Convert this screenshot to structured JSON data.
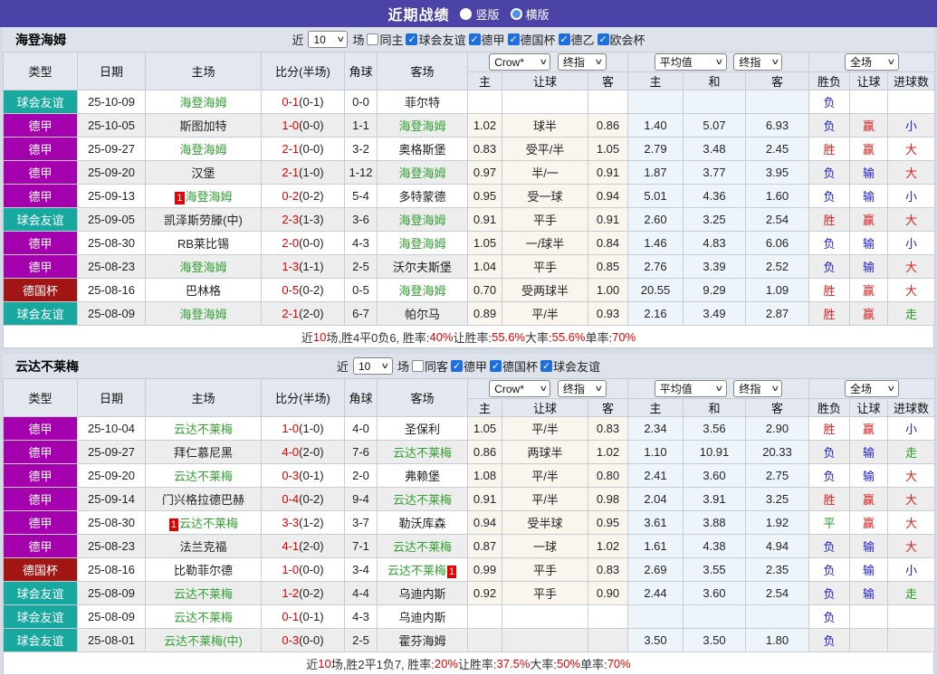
{
  "title_bar": {
    "title": "近期战绩",
    "vertical": "竖版",
    "horizontal": "横版",
    "selected": "竖版"
  },
  "colors": {
    "title_bar_bg": "#4b43a6",
    "highlight_team": "#33a033",
    "score_red": "#e60000",
    "odds_col_bg": "#faf6ee",
    "avg_col_bg": "#edf5fb"
  },
  "type_colors": {
    "球会友谊": "#18a8a0",
    "德甲": "#a400ae",
    "德国杯": "#a21515"
  },
  "value_colors": {
    "胜": "#d92222",
    "赢": "#d92222",
    "大": "#d92222",
    "负": "#2222cc",
    "输": "#2222cc",
    "小": "#2222cc",
    "平": "#229922",
    "走": "#229922"
  },
  "table_header": {
    "type": "类型",
    "date": "日期",
    "home": "主场",
    "score": "比分(半场)",
    "corner": "角球",
    "away": "客场",
    "odds_source_select": "Crow*",
    "odds_final_select": "终指",
    "avg_select": "平均值",
    "avg_final_select": "终指",
    "scope_select": "全场",
    "odds_home": "主",
    "odds_handicap": "让球",
    "odds_away": "客",
    "avg_home": "主",
    "avg_draw": "和",
    "avg_away": "客",
    "result": "胜负",
    "handicap": "让球",
    "goals": "进球数"
  },
  "sections": [
    {
      "team": "海登海姆",
      "filters": {
        "near_label": "近",
        "count": "10",
        "games_label": "场",
        "same_label": "同主",
        "leagues": [
          "球会友谊",
          "德甲",
          "德国杯",
          "德乙",
          "欧会杯"
        ]
      },
      "rows": [
        {
          "type": "球会友谊",
          "date": "25-10-09",
          "home": "海登海姆",
          "home_hl": true,
          "home_badge": "",
          "score": "0-1",
          "half": "(0-1)",
          "corner": "0-0",
          "away": "菲尔特",
          "away_hl": false,
          "away_badge": "",
          "crow": [
            "",
            "",
            ""
          ],
          "avg": [
            "",
            "",
            ""
          ],
          "result": "负",
          "handicap_result": "",
          "goals": ""
        },
        {
          "type": "德甲",
          "date": "25-10-05",
          "home": "斯图加特",
          "home_hl": false,
          "home_badge": "",
          "score": "1-0",
          "half": "(0-0)",
          "corner": "1-1",
          "away": "海登海姆",
          "away_hl": true,
          "away_badge": "",
          "crow": [
            "1.02",
            "球半",
            "0.86"
          ],
          "avg": [
            "1.40",
            "5.07",
            "6.93"
          ],
          "result": "负",
          "handicap_result": "赢",
          "goals": "小"
        },
        {
          "type": "德甲",
          "date": "25-09-27",
          "home": "海登海姆",
          "home_hl": true,
          "home_badge": "",
          "score": "2-1",
          "half": "(0-0)",
          "corner": "3-2",
          "away": "奥格斯堡",
          "away_hl": false,
          "away_badge": "",
          "crow": [
            "0.83",
            "受平/半",
            "1.05"
          ],
          "avg": [
            "2.79",
            "3.48",
            "2.45"
          ],
          "result": "胜",
          "handicap_result": "赢",
          "goals": "大"
        },
        {
          "type": "德甲",
          "date": "25-09-20",
          "home": "汉堡",
          "home_hl": false,
          "home_badge": "",
          "score": "2-1",
          "half": "(1-0)",
          "corner": "1-12",
          "away": "海登海姆",
          "away_hl": true,
          "away_badge": "",
          "crow": [
            "0.97",
            "半/一",
            "0.91"
          ],
          "avg": [
            "1.87",
            "3.77",
            "3.95"
          ],
          "result": "负",
          "handicap_result": "输",
          "goals": "大"
        },
        {
          "type": "德甲",
          "date": "25-09-13",
          "home": "海登海姆",
          "home_hl": true,
          "home_badge": "1",
          "score": "0-2",
          "half": "(0-2)",
          "corner": "5-4",
          "away": "多特蒙德",
          "away_hl": false,
          "away_badge": "",
          "crow": [
            "0.95",
            "受一球",
            "0.94"
          ],
          "avg": [
            "5.01",
            "4.36",
            "1.60"
          ],
          "result": "负",
          "handicap_result": "输",
          "goals": "小"
        },
        {
          "type": "球会友谊",
          "date": "25-09-05",
          "home": "凯泽斯劳滕(中)",
          "home_hl": false,
          "home_badge": "",
          "score": "2-3",
          "half": "(1-3)",
          "corner": "3-6",
          "away": "海登海姆",
          "away_hl": true,
          "away_badge": "",
          "crow": [
            "0.91",
            "平手",
            "0.91"
          ],
          "avg": [
            "2.60",
            "3.25",
            "2.54"
          ],
          "result": "胜",
          "handicap_result": "赢",
          "goals": "大"
        },
        {
          "type": "德甲",
          "date": "25-08-30",
          "home": "RB莱比锡",
          "home_hl": false,
          "home_badge": "",
          "score": "2-0",
          "half": "(0-0)",
          "corner": "4-3",
          "away": "海登海姆",
          "away_hl": true,
          "away_badge": "",
          "crow": [
            "1.05",
            "一/球半",
            "0.84"
          ],
          "avg": [
            "1.46",
            "4.83",
            "6.06"
          ],
          "result": "负",
          "handicap_result": "输",
          "goals": "小"
        },
        {
          "type": "德甲",
          "date": "25-08-23",
          "home": "海登海姆",
          "home_hl": true,
          "home_badge": "",
          "score": "1-3",
          "half": "(1-1)",
          "corner": "2-5",
          "away": "沃尔夫斯堡",
          "away_hl": false,
          "away_badge": "",
          "crow": [
            "1.04",
            "平手",
            "0.85"
          ],
          "avg": [
            "2.76",
            "3.39",
            "2.52"
          ],
          "result": "负",
          "handicap_result": "输",
          "goals": "大"
        },
        {
          "type": "德国杯",
          "date": "25-08-16",
          "home": "巴林格",
          "home_hl": false,
          "home_badge": "",
          "score": "0-5",
          "half": "(0-2)",
          "corner": "0-5",
          "away": "海登海姆",
          "away_hl": true,
          "away_badge": "",
          "crow": [
            "0.70",
            "受两球半",
            "1.00"
          ],
          "avg": [
            "20.55",
            "9.29",
            "1.09"
          ],
          "result": "胜",
          "handicap_result": "赢",
          "goals": "大"
        },
        {
          "type": "球会友谊",
          "date": "25-08-09",
          "home": "海登海姆",
          "home_hl": true,
          "home_badge": "",
          "score": "2-1",
          "half": "(2-0)",
          "corner": "6-7",
          "away": "帕尔马",
          "away_hl": false,
          "away_badge": "",
          "crow": [
            "0.89",
            "平/半",
            "0.93"
          ],
          "avg": [
            "2.16",
            "3.49",
            "2.87"
          ],
          "result": "胜",
          "handicap_result": "赢",
          "goals": "走"
        }
      ],
      "summary": [
        {
          "text": "近",
          "red": false
        },
        {
          "text": "10",
          "red": true
        },
        {
          "text": "场,胜4平0负6, 胜率:",
          "red": false
        },
        {
          "text": "40%",
          "red": true
        },
        {
          "text": " 让胜率:",
          "red": false
        },
        {
          "text": "55.6%",
          "red": true
        },
        {
          "text": " 大率:",
          "red": false
        },
        {
          "text": "55.6%",
          "red": true
        },
        {
          "text": " 单率:",
          "red": false
        },
        {
          "text": "70%",
          "red": true
        }
      ]
    },
    {
      "team": "云达不莱梅",
      "filters": {
        "near_label": "近",
        "count": "10",
        "games_label": "场",
        "same_label": "同客",
        "leagues": [
          "德甲",
          "德国杯",
          "球会友谊"
        ]
      },
      "rows": [
        {
          "type": "德甲",
          "date": "25-10-04",
          "home": "云达不莱梅",
          "home_hl": true,
          "home_badge": "",
          "score": "1-0",
          "half": "(1-0)",
          "corner": "4-0",
          "away": "圣保利",
          "away_hl": false,
          "away_badge": "",
          "crow": [
            "1.05",
            "平/半",
            "0.83"
          ],
          "avg": [
            "2.34",
            "3.56",
            "2.90"
          ],
          "result": "胜",
          "handicap_result": "赢",
          "goals": "小"
        },
        {
          "type": "德甲",
          "date": "25-09-27",
          "home": "拜仁慕尼黑",
          "home_hl": false,
          "home_badge": "",
          "score": "4-0",
          "half": "(2-0)",
          "corner": "7-6",
          "away": "云达不莱梅",
          "away_hl": true,
          "away_badge": "",
          "crow": [
            "0.86",
            "两球半",
            "1.02"
          ],
          "avg": [
            "1.10",
            "10.91",
            "20.33"
          ],
          "result": "负",
          "handicap_result": "输",
          "goals": "走"
        },
        {
          "type": "德甲",
          "date": "25-09-20",
          "home": "云达不莱梅",
          "home_hl": true,
          "home_badge": "",
          "score": "0-3",
          "half": "(0-1)",
          "corner": "2-0",
          "away": "弗赖堡",
          "away_hl": false,
          "away_badge": "",
          "crow": [
            "1.08",
            "平/半",
            "0.80"
          ],
          "avg": [
            "2.41",
            "3.60",
            "2.75"
          ],
          "result": "负",
          "handicap_result": "输",
          "goals": "大"
        },
        {
          "type": "德甲",
          "date": "25-09-14",
          "home": "门兴格拉德巴赫",
          "home_hl": false,
          "home_badge": "",
          "score": "0-4",
          "half": "(0-2)",
          "corner": "9-4",
          "away": "云达不莱梅",
          "away_hl": true,
          "away_badge": "",
          "crow": [
            "0.91",
            "平/半",
            "0.98"
          ],
          "avg": [
            "2.04",
            "3.91",
            "3.25"
          ],
          "result": "胜",
          "handicap_result": "赢",
          "goals": "大"
        },
        {
          "type": "德甲",
          "date": "25-08-30",
          "home": "云达不莱梅",
          "home_hl": true,
          "home_badge": "1",
          "score": "3-3",
          "half": "(1-2)",
          "corner": "3-7",
          "away": "勒沃库森",
          "away_hl": false,
          "away_badge": "",
          "crow": [
            "0.94",
            "受半球",
            "0.95"
          ],
          "avg": [
            "3.61",
            "3.88",
            "1.92"
          ],
          "result": "平",
          "handicap_result": "赢",
          "goals": "大"
        },
        {
          "type": "德甲",
          "date": "25-08-23",
          "home": "法兰克福",
          "home_hl": false,
          "home_badge": "",
          "score": "4-1",
          "half": "(2-0)",
          "corner": "7-1",
          "away": "云达不莱梅",
          "away_hl": true,
          "away_badge": "",
          "crow": [
            "0.87",
            "一球",
            "1.02"
          ],
          "avg": [
            "1.61",
            "4.38",
            "4.94"
          ],
          "result": "负",
          "handicap_result": "输",
          "goals": "大"
        },
        {
          "type": "德国杯",
          "date": "25-08-16",
          "home": "比勒菲尔德",
          "home_hl": false,
          "home_badge": "",
          "score": "1-0",
          "half": "(0-0)",
          "corner": "3-4",
          "away": "云达不莱梅",
          "away_hl": true,
          "away_badge": "1",
          "crow": [
            "0.99",
            "平手",
            "0.83"
          ],
          "avg": [
            "2.69",
            "3.55",
            "2.35"
          ],
          "result": "负",
          "handicap_result": "输",
          "goals": "小"
        },
        {
          "type": "球会友谊",
          "date": "25-08-09",
          "home": "云达不莱梅",
          "home_hl": true,
          "home_badge": "",
          "score": "1-2",
          "half": "(0-2)",
          "corner": "4-4",
          "away": "乌迪内斯",
          "away_hl": false,
          "away_badge": "",
          "crow": [
            "0.92",
            "平手",
            "0.90"
          ],
          "avg": [
            "2.44",
            "3.60",
            "2.54"
          ],
          "result": "负",
          "handicap_result": "输",
          "goals": "走"
        },
        {
          "type": "球会友谊",
          "date": "25-08-09",
          "home": "云达不莱梅",
          "home_hl": true,
          "home_badge": "",
          "score": "0-1",
          "half": "(0-1)",
          "corner": "4-3",
          "away": "乌迪内斯",
          "away_hl": false,
          "away_badge": "",
          "crow": [
            "",
            "",
            ""
          ],
          "avg": [
            "",
            "",
            ""
          ],
          "result": "负",
          "handicap_result": "",
          "goals": ""
        },
        {
          "type": "球会友谊",
          "date": "25-08-01",
          "home": "云达不莱梅(中)",
          "home_hl": true,
          "home_badge": "",
          "score": "0-3",
          "half": "(0-0)",
          "corner": "2-5",
          "away": "霍芬海姆",
          "away_hl": false,
          "away_badge": "",
          "crow": [
            "",
            "",
            ""
          ],
          "avg": [
            "3.50",
            "3.50",
            "1.80"
          ],
          "result": "负",
          "handicap_result": "",
          "goals": ""
        }
      ],
      "summary": [
        {
          "text": "近",
          "red": false
        },
        {
          "text": "10",
          "red": true
        },
        {
          "text": "场,胜2平1负7, 胜率:",
          "red": false
        },
        {
          "text": "20%",
          "red": true
        },
        {
          "text": " 让胜率:",
          "red": false
        },
        {
          "text": "37.5%",
          "red": true
        },
        {
          "text": " 大率:",
          "red": false
        },
        {
          "text": "50%",
          "red": true
        },
        {
          "text": " 单率:",
          "red": false
        },
        {
          "text": "70%",
          "red": true
        }
      ]
    }
  ]
}
